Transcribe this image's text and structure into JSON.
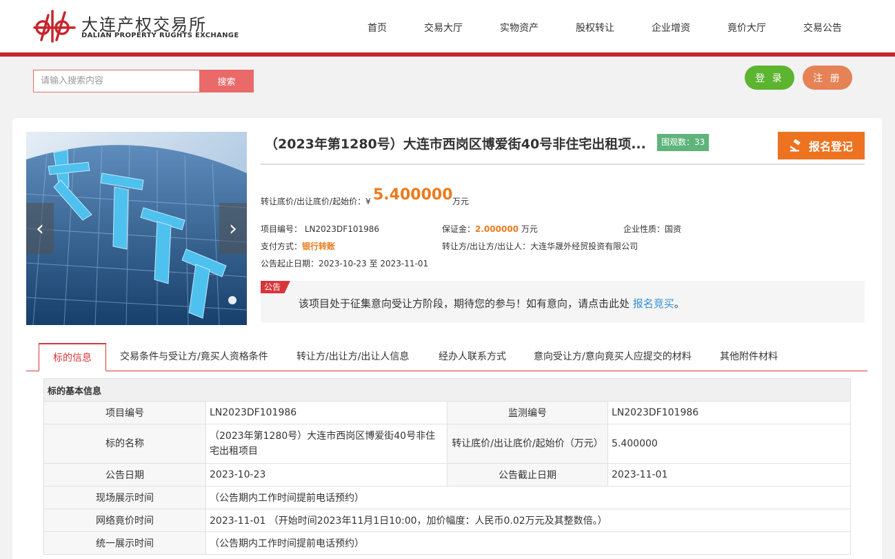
{
  "brand": {
    "name_cn": "大连产权交易所",
    "name_en": "DALIAN PROPERTY RUGHTS EXCHANGE",
    "brand_color": "#c8252c"
  },
  "nav": [
    "首页",
    "交易大厅",
    "实物资产",
    "股权转让",
    "企业增资",
    "竟价大厅",
    "交易公告"
  ],
  "search": {
    "placeholder": "请输入搜索内容",
    "button": "搜索"
  },
  "auth": {
    "login": "登 录",
    "register": "注 册"
  },
  "project": {
    "title": "（2023年第1280号）大连市西岗区博爱街40号非住宅出租项...",
    "views_label": "围观数：",
    "views": "33",
    "signup_button": "报名登记",
    "price_label": "转让底价/出让底价/起始价：",
    "currency": "¥",
    "price": "5.400000",
    "price_unit": "万元",
    "fields": {
      "project_no_label": "项目编号：",
      "project_no": "LN2023DF101986",
      "deposit_label": "保证金：",
      "deposit": "2.000000",
      "deposit_unit": "万元",
      "nature_label": "企业性质：",
      "nature": "国资",
      "payment_label": "支付方式：",
      "payment": "银行转账",
      "transferor_label": "转让方/出让方/出让人：",
      "transferor": "大连华晟外经贸投资有限公司",
      "date_label": "公告起止日期：",
      "date_range": "2023-10-23 至 2023-11-01"
    },
    "notice_tag": "公告",
    "notice_text": "该项目处于征集意向受让方阶段，期待您的参与！如有意向，请点击此处 ",
    "notice_link": "报名竞买",
    "notice_end": "。"
  },
  "carousel": {
    "prev": "‹",
    "next": "›"
  },
  "tabs": [
    "标的信息",
    "交易条件与受让方/竟买人资格条件",
    "转让方/出让方/出让人信息",
    "经办人联系方式",
    "意向受让方/意向竟买人应提交的材料",
    "其他附件材料"
  ],
  "table": {
    "section_title": "标的基本信息",
    "rows": [
      {
        "l1": "项目编号",
        "v1": "LN2023DF101986",
        "l2": "监测编号",
        "v2": "LN2023DF101986"
      },
      {
        "l1": "标的名称",
        "v1": "（2023年第1280号）大连市西岗区博爱街40号非住宅出租项目",
        "l2": "转让底价/出让底价/起始价（万元）",
        "v2": "5.400000"
      },
      {
        "l1": "公告日期",
        "v1": "2023-10-23",
        "l2": "公告截止日期",
        "v2": "2023-11-01"
      },
      {
        "l1": "现场展示时间",
        "v1": "（公告期内工作时间提前电话预约）"
      },
      {
        "l1": "网络竟价时间",
        "v1": "2023-11-01 （开始时间2023年11月1日10:00，加价幅度：人民币0.02万元及其整数倍。）"
      },
      {
        "l1": "统一展示时间",
        "v1": "（公告期内工作时间提前电话预约）"
      }
    ]
  },
  "colors": {
    "accent_red": "#d8353a",
    "orange": "#ec7a1c",
    "green": "#5cb42f",
    "badge_green": "#5fb47c",
    "link_blue": "#2f8fd8"
  }
}
